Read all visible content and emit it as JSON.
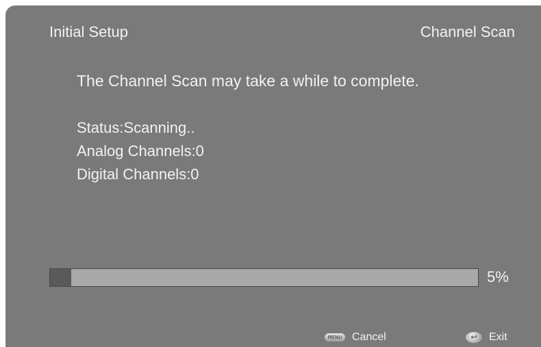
{
  "header": {
    "title": "Initial Setup",
    "section": "Channel Scan"
  },
  "main": {
    "message": "The Channel Scan may take a while to complete.",
    "status": "Status:Scanning..",
    "analog_channels": "Analog Channels:0",
    "digital_channels": "Digital Channels:0"
  },
  "progress": {
    "value_percent": 5,
    "label": "5%"
  },
  "footer": {
    "cancel_icon_text": "MENU",
    "cancel_label": "Cancel",
    "exit_icon": "return-arrow-icon",
    "exit_label": "Exit"
  },
  "colors": {
    "background": "#7a7a7a",
    "text": "#f2f2f2",
    "progress_track": "#a9a9a9",
    "progress_fill": "#5a5a5a"
  }
}
